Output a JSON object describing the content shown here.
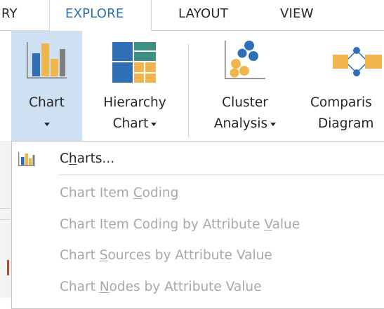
{
  "tabs": [
    {
      "label": "RY",
      "active": false
    },
    {
      "label": "EXPLORE",
      "active": true
    },
    {
      "label": "LAYOUT",
      "active": false
    },
    {
      "label": "VIEW",
      "active": false
    }
  ],
  "ribbon": {
    "chart": {
      "line1": "Chart",
      "pressed": true,
      "icon": "bar-chart-icon"
    },
    "hierarchy_chart": {
      "line1": "Hierarchy",
      "line2": "Chart",
      "icon": "treemap-icon"
    },
    "cluster_analysis": {
      "line1": "Cluster",
      "line2": "Analysis",
      "icon": "cluster-icon"
    },
    "comparison_diagram": {
      "line1": "Comparis",
      "line2": "Diagram",
      "icon": "comparison-diagram-icon"
    }
  },
  "menu": {
    "charts": {
      "pre": "C",
      "hot": "h",
      "post": "arts...",
      "enabled": true,
      "icon": "bar-chart-icon"
    },
    "chart_item_coding": {
      "pre": "Chart Item ",
      "hot": "C",
      "post": "oding",
      "enabled": false
    },
    "chart_item_coding_attr": {
      "pre": "Chart Item Coding by Attribute ",
      "hot": "V",
      "post": "alue",
      "enabled": false
    },
    "chart_sources_attr": {
      "pre": "Chart ",
      "hot": "S",
      "post": "ources by Attribute Value",
      "enabled": false
    },
    "chart_nodes_attr": {
      "pre": "Chart ",
      "hot": "N",
      "post": "odes by Attribute Value",
      "enabled": false
    }
  },
  "colors": {
    "accent_tab": "#2b6cb3",
    "pressed_bg": "#cfe0f3",
    "chart_blue": "#2f6fb5",
    "chart_orange": "#f0b54b",
    "chart_gray": "#7f7f7f",
    "tree_blue": "#2f6fb5",
    "tree_teal": "#3f8f84",
    "tree_gold": "#f0b54b",
    "disabled_text": "#a8a8a8"
  }
}
